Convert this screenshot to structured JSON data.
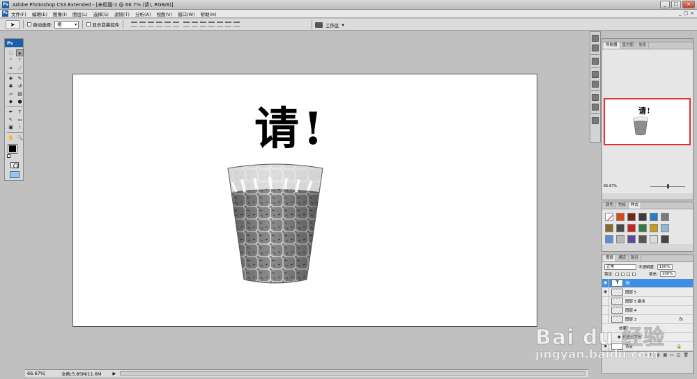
{
  "window": {
    "title": "Adobe Photoshop CS3 Extended - [未标题-1 @ 66.7% (请!, RGB/8)]",
    "app_badge": "Ps",
    "controls": [
      "_",
      "□",
      "×"
    ]
  },
  "menubar": {
    "items": [
      "文件(F)",
      "编辑(E)",
      "图像(I)",
      "图层(L)",
      "选择(S)",
      "滤镜(T)",
      "分析(A)",
      "视图(V)",
      "窗口(W)",
      "帮助(H)"
    ],
    "right_controls": [
      "_",
      "□",
      "×"
    ]
  },
  "options": {
    "auto_select_label": "自动选择:",
    "auto_select_value": "组",
    "show_transform_label": "显示变换控件",
    "workspace_label": "工作区"
  },
  "toolbox": {
    "header": "Ps",
    "tools": [
      {
        "name": "marquee-tool",
        "glyph": "◌"
      },
      {
        "name": "move-tool",
        "glyph": "➤",
        "active": true
      },
      {
        "name": "lasso-tool",
        "glyph": "ᘁ"
      },
      {
        "name": "magic-wand-tool",
        "glyph": "⚚"
      },
      {
        "name": "crop-tool",
        "glyph": "⌗"
      },
      {
        "name": "slice-tool",
        "glyph": "⟋"
      },
      {
        "name": "healing-tool",
        "glyph": "✚"
      },
      {
        "name": "brush-tool",
        "glyph": "✎"
      },
      {
        "name": "stamp-tool",
        "glyph": "♣"
      },
      {
        "name": "history-brush-tool",
        "glyph": "↺"
      },
      {
        "name": "eraser-tool",
        "glyph": "▱"
      },
      {
        "name": "gradient-tool",
        "glyph": "▤"
      },
      {
        "name": "blur-tool",
        "glyph": "◆"
      },
      {
        "name": "dodge-tool",
        "glyph": "●"
      },
      {
        "name": "pen-tool",
        "glyph": "✒"
      },
      {
        "name": "type-tool",
        "glyph": "T"
      },
      {
        "name": "path-select-tool",
        "glyph": "↖"
      },
      {
        "name": "shape-tool",
        "glyph": "▭"
      },
      {
        "name": "notes-tool",
        "glyph": "▣"
      },
      {
        "name": "eyedropper-tool",
        "glyph": "⟊"
      },
      {
        "name": "hand-tool",
        "glyph": "✋"
      },
      {
        "name": "zoom-tool",
        "glyph": "🔍"
      }
    ]
  },
  "document": {
    "text": "请!"
  },
  "status": {
    "zoom": "66.67%",
    "doc_info": "文档:5.85M/11.6M",
    "arrow": "▶"
  },
  "navigator": {
    "tabs": [
      "导航器",
      "直方图",
      "信息"
    ],
    "preview_text": "请!",
    "zoom": "66.67%"
  },
  "styles_panel": {
    "tabs": [
      "颜色",
      "色板",
      "样式"
    ],
    "swatches": [
      "none",
      "#d9471c",
      "#6e2a12",
      "#3b3b3b",
      "#2d7cc4",
      "#7a7a7a",
      "#8a6a2c",
      "#4a4a4a",
      "#c82424",
      "#3a7a3a",
      "#c89a20",
      "#8fb5d8",
      "#5d8ed1",
      "#b8b8b8",
      "#5a4a9a",
      "#555555",
      "#dcdcdc",
      "#444444"
    ],
    "foot": [
      "▭",
      "◱",
      "🗑"
    ]
  },
  "layers_panel": {
    "tabs": [
      "图层",
      "通道",
      "路径"
    ],
    "blend_mode": "正常",
    "opacity_label": "不透明度:",
    "opacity": "100%",
    "lock_label": "锁定:",
    "fill_label": "填充:",
    "fill": "100%",
    "layers": [
      {
        "name": "请!",
        "thumb": "T",
        "kind": "text",
        "visible": true,
        "selected": true
      },
      {
        "name": "图层 5",
        "thumb": "",
        "kind": "trans",
        "visible": true
      },
      {
        "name": "图层 5 副本",
        "thumb": "",
        "kind": "trans",
        "visible": false
      },
      {
        "name": "图层 4",
        "thumb": "",
        "kind": "trans",
        "visible": false
      },
      {
        "name": "图层 3",
        "thumb": "",
        "kind": "trans",
        "visible": false,
        "fx": "fx"
      },
      {
        "name": "效果",
        "thumb": "",
        "kind": "sub",
        "visible": false
      },
      {
        "name": "斜面和浮雕",
        "thumb": "",
        "kind": "sub",
        "visible": true
      },
      {
        "name": "背景",
        "thumb": "",
        "kind": "white",
        "visible": true,
        "locked": true
      }
    ],
    "foot": [
      "∞",
      "fx",
      "◐",
      "▦",
      "▭",
      "◱",
      "🗑"
    ]
  },
  "watermark": {
    "main": "Bai du 经验",
    "sub": "jingyan.baidu.com"
  }
}
